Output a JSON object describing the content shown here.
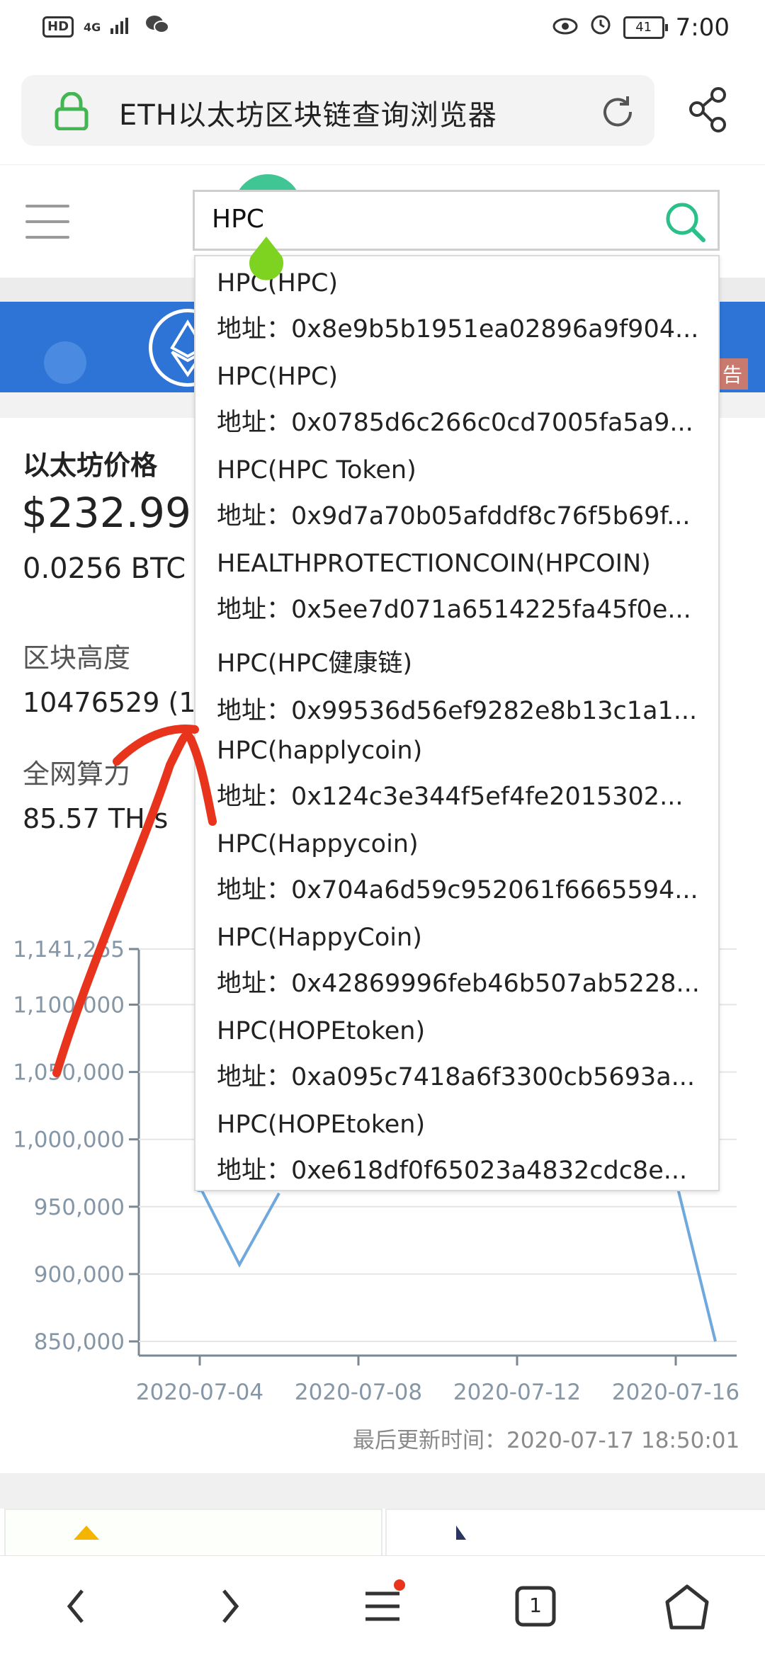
{
  "status_bar": {
    "hd": "HD",
    "network": "4G",
    "battery": "41",
    "time": "7:00"
  },
  "browser": {
    "title": "ETH以太坊区块链查询浏览器"
  },
  "search": {
    "value": "HPC"
  },
  "banner": {
    "ad_label": "告"
  },
  "stats": {
    "price_label": "以太坊价格",
    "price_value": "$232.99 ≈",
    "price_btc": "0.0256 BTC",
    "block_height_label": "区块高度",
    "block_height_value": "10476529 (13",
    "hashrate_label": "全网算力",
    "hashrate_value": "85.57 TH/s"
  },
  "dropdown": {
    "items": [
      {
        "name": "HPC(HPC)",
        "address": "地址：0x8e9b5b1951ea02896a9f904..."
      },
      {
        "name": "HPC(HPC)",
        "address": "地址：0x0785d6c266c0cd7005fa5a9..."
      },
      {
        "name": "HPC(HPC Token)",
        "address": "地址：0x9d7a70b05afddf8c76f5b69f..."
      },
      {
        "name": "HEALTHPROTECTIONCOIN(HPCOIN)",
        "address": "地址：0x5ee7d071a6514225fa45f0e..."
      },
      {
        "name": "HPC(HPC健康链)",
        "address": "地址：0x99536d56ef9282e8b13c1a1..."
      },
      {
        "name": "HPC(happlycoin)",
        "address": "地址：0x124c3e344f5ef4fe2015302..."
      },
      {
        "name": "HPC(Happycoin)",
        "address": "地址：0x704a6d59c952061f6665594..."
      },
      {
        "name": "HPC(HappyCoin)",
        "address": "地址：0x42869996feb46b507ab5228..."
      },
      {
        "name": "HPC(HOPEtoken)",
        "address": "地址：0xa095c7418a6f3300cb5693a..."
      },
      {
        "name": "HPC(HOPEtoken)",
        "address": "地址：0xe618df0f65023a4832cdc8e..."
      }
    ]
  },
  "chart_data": {
    "type": "line",
    "y_ticks": [
      "1,141,265",
      "1,100,000",
      "1,050,000",
      "1,000,000",
      "950,000",
      "900,000",
      "850,000"
    ],
    "ylim": [
      850000,
      1141265
    ],
    "x_ticks": [
      "2020-07-04",
      "2020-07-08",
      "2020-07-12",
      "2020-07-16"
    ],
    "series": [
      {
        "values_visible": [
          {
            "x": "2020-07-04",
            "y": 965000
          },
          {
            "x": "2020-07-05",
            "y": 907000
          },
          {
            "x": "2020-07-06",
            "y": 960000
          },
          {
            "x": "2020-07-16",
            "y": 970000
          },
          {
            "x": "2020-07-17",
            "y": 850000
          }
        ]
      }
    ],
    "line_color": "#6fa8dc"
  },
  "updated": "最后更新时间：2020-07-17 18:50:01",
  "navbar": {
    "tabs_count": "1"
  },
  "colors": {
    "banner": "#2e74d6",
    "annotation": "#e8341c",
    "handle": "#7ed321"
  }
}
